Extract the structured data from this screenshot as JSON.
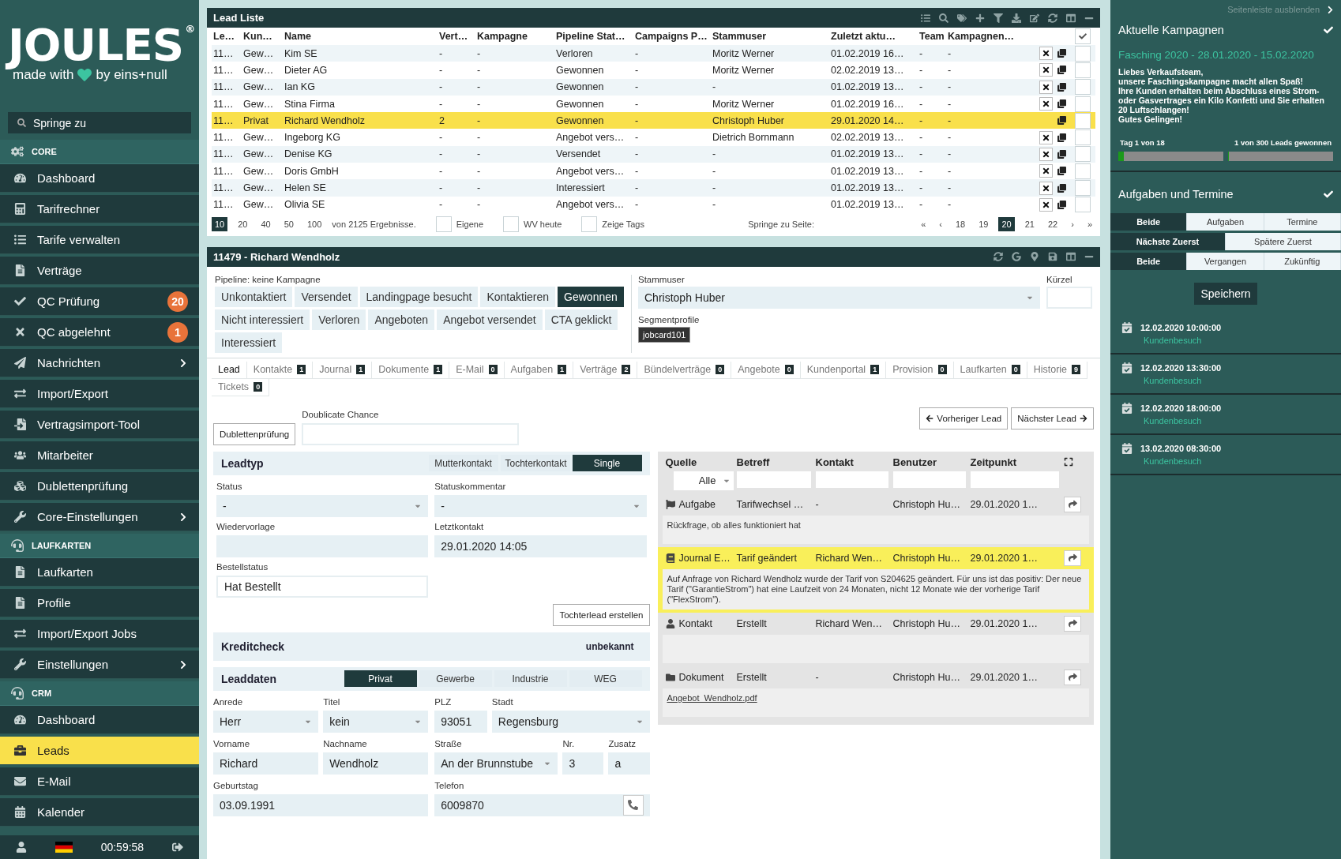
{
  "sidebar": {
    "logo": {
      "wordmark": "JOULES",
      "mark": "®",
      "tagline_start": "made with",
      "tagline_end": "by eins+null"
    },
    "search": {
      "placeholder": "Springe zu"
    },
    "sections": [
      {
        "title": "CORE",
        "items": [
          {
            "label": "Dashboard",
            "submenu": false,
            "selected": false
          },
          {
            "label": "Tarifrechner",
            "submenu": false,
            "selected": false
          },
          {
            "label": "Tarife verwalten",
            "submenu": false,
            "selected": false
          },
          {
            "label": "Verträge",
            "submenu": false,
            "selected": false
          },
          {
            "label": "QC Prüfung",
            "badge": "20",
            "submenu": false,
            "selected": false
          },
          {
            "label": "QC abgelehnt",
            "badge": "1",
            "submenu": false,
            "selected": false
          },
          {
            "label": "Nachrichten",
            "submenu": true,
            "selected": false
          },
          {
            "label": "Import/Export",
            "submenu": false,
            "selected": false
          },
          {
            "label": "Vertragsimport-Tool",
            "submenu": false,
            "selected": false
          },
          {
            "label": "Mitarbeiter",
            "submenu": false,
            "selected": false
          },
          {
            "label": "Dublettenprüfung",
            "submenu": false,
            "selected": false
          },
          {
            "label": "Core-Einstellungen",
            "submenu": true,
            "selected": false
          }
        ]
      },
      {
        "title": "LAUFKARTEN",
        "items": [
          {
            "label": "Laufkarten",
            "submenu": false,
            "selected": false
          },
          {
            "label": "Profile",
            "submenu": false,
            "selected": false
          },
          {
            "label": "Import/Export Jobs",
            "submenu": false,
            "selected": false
          },
          {
            "label": "Einstellungen",
            "submenu": true,
            "selected": false
          }
        ]
      },
      {
        "title": "CRM",
        "items": [
          {
            "label": "Dashboard",
            "submenu": false,
            "selected": false
          },
          {
            "label": "Leads",
            "submenu": false,
            "selected": true
          },
          {
            "label": "E-Mail",
            "submenu": false,
            "selected": false
          },
          {
            "label": "Kalender",
            "submenu": false,
            "selected": false
          }
        ]
      }
    ],
    "footer": {
      "time": "00:59:58"
    }
  },
  "lead_list": {
    "title": "Lead Liste",
    "all_checked": true,
    "columns": [
      "Le…",
      "Kun…",
      "Name",
      "Vert…",
      "Kampagne",
      "Pipeline Stat…",
      "Campaigns P…",
      "Stammuser",
      "Zuletzt aktu…",
      "Team",
      "Kampagnen…"
    ],
    "rows": [
      {
        "cells": [
          "11…",
          "Gew…",
          "Kim SE",
          "-",
          "-",
          "Verloren",
          "-",
          "Moritz Werner",
          "01.02.2019 16…",
          "-",
          "-"
        ],
        "deletable": true,
        "checked": false,
        "selected": false
      },
      {
        "cells": [
          "11…",
          "Gew…",
          "Dieter AG",
          "-",
          "-",
          "Gewonnen",
          "-",
          "Moritz Werner",
          "02.02.2019 13…",
          "-",
          "-"
        ],
        "deletable": true,
        "checked": false,
        "selected": false
      },
      {
        "cells": [
          "11…",
          "Gew…",
          "Ian KG",
          "-",
          "-",
          "Gewonnen",
          "-",
          "-",
          "01.02.2019 13…",
          "-",
          "-"
        ],
        "deletable": true,
        "checked": false,
        "selected": false
      },
      {
        "cells": [
          "11…",
          "Gew…",
          "Stina Firma",
          "-",
          "-",
          "Gewonnen",
          "-",
          "Moritz Werner",
          "01.02.2019 16…",
          "-",
          "-"
        ],
        "deletable": true,
        "checked": false,
        "selected": false
      },
      {
        "cells": [
          "11…",
          "Privat",
          "Richard Wendholz",
          "2",
          "-",
          "Gewonnen",
          "-",
          "Christoph Huber",
          "29.01.2020 14…",
          "-",
          "-"
        ],
        "deletable": false,
        "checked": false,
        "selected": true
      },
      {
        "cells": [
          "11…",
          "Gew…",
          "Ingeborg KG",
          "-",
          "-",
          "Angebot vers…",
          "-",
          "Dietrich Bornmann",
          "02.02.2019 13…",
          "-",
          "-"
        ],
        "deletable": true,
        "checked": false,
        "selected": false
      },
      {
        "cells": [
          "11…",
          "Gew…",
          "Denise KG",
          "-",
          "-",
          "Versendet",
          "-",
          "-",
          "01.02.2019 13…",
          "-",
          "-"
        ],
        "deletable": true,
        "checked": false,
        "selected": false
      },
      {
        "cells": [
          "11…",
          "Gew…",
          "Doris GmbH",
          "-",
          "-",
          "Angebot vers…",
          "-",
          "-",
          "01.02.2019 13…",
          "-",
          "-"
        ],
        "deletable": true,
        "checked": false,
        "selected": false
      },
      {
        "cells": [
          "11…",
          "Gew…",
          "Helen SE",
          "-",
          "-",
          "Interessiert",
          "-",
          "-",
          "01.02.2019 13…",
          "-",
          "-"
        ],
        "deletable": true,
        "checked": false,
        "selected": false
      },
      {
        "cells": [
          "11…",
          "Gew…",
          "Olivia SE",
          "-",
          "-",
          "Angebot vers…",
          "-",
          "-",
          "01.02.2019 13…",
          "-",
          "-"
        ],
        "deletable": true,
        "checked": false,
        "selected": false
      }
    ],
    "page_sizes": [
      {
        "label": "10",
        "selected": true
      },
      {
        "label": "20",
        "selected": false
      },
      {
        "label": "40",
        "selected": false
      },
      {
        "label": "50",
        "selected": false
      },
      {
        "label": "100",
        "selected": false
      }
    ],
    "result_count": "von 2125 Ergebnisse.",
    "filters": [
      {
        "label": "Eigene",
        "checked": false
      },
      {
        "label": "WV heute",
        "checked": false
      },
      {
        "label": "Zeige Tags",
        "checked": false
      }
    ],
    "jump_label": "Springe zu Seite:",
    "pages": [
      {
        "label": "«",
        "selected": false
      },
      {
        "label": "‹",
        "selected": false
      },
      {
        "label": "18",
        "selected": false
      },
      {
        "label": "19",
        "selected": false
      },
      {
        "label": "20",
        "selected": true
      },
      {
        "label": "21",
        "selected": false
      },
      {
        "label": "22",
        "selected": false
      },
      {
        "label": "›",
        "selected": false
      },
      {
        "label": "»",
        "selected": false
      }
    ]
  },
  "detail": {
    "title": "11479 - Richard Wendholz",
    "pipeline_label": "Pipeline: keine Kampagne",
    "stages": [
      {
        "label": "Unkontaktiert",
        "selected": false
      },
      {
        "label": "Versendet",
        "selected": false
      },
      {
        "label": "Landingpage besucht",
        "selected": false
      },
      {
        "label": "Kontaktieren",
        "selected": false
      },
      {
        "label": "Gewonnen",
        "selected": true
      },
      {
        "label": "Nicht interessiert",
        "selected": false
      },
      {
        "label": "Verloren",
        "selected": false
      },
      {
        "label": "Angeboten",
        "selected": false
      },
      {
        "label": "Angebot versendet",
        "selected": false
      },
      {
        "label": "CTA geklickt",
        "selected": false
      },
      {
        "label": "Interessiert",
        "selected": false
      }
    ],
    "owner": {
      "label": "Stammuser",
      "value": "Christoph Huber"
    },
    "short_label": "Kürzel",
    "segments": {
      "label": "Segmentprofile",
      "tags": [
        "jobcard101"
      ]
    },
    "tabs": [
      {
        "label": "Lead",
        "selected": true
      },
      {
        "label": "Kontakte",
        "count": "1",
        "selected": false
      },
      {
        "label": "Journal",
        "count": "1",
        "selected": false
      },
      {
        "label": "Dokumente",
        "count": "1",
        "selected": false
      },
      {
        "label": "E-Mail",
        "count": "0",
        "selected": false
      },
      {
        "label": "Aufgaben",
        "count": "1",
        "selected": false
      },
      {
        "label": "Verträge",
        "count": "2",
        "selected": false
      },
      {
        "label": "Bündelverträge",
        "count": "0",
        "selected": false
      },
      {
        "label": "Angebote",
        "count": "0",
        "selected": false
      },
      {
        "label": "Kundenportal",
        "count": "1",
        "selected": false
      },
      {
        "label": "Provision",
        "count": "0",
        "selected": false
      },
      {
        "label": "Laufkarten",
        "count": "0",
        "selected": false
      },
      {
        "label": "Historie",
        "count": "9",
        "selected": false
      },
      {
        "label": "Tickets",
        "count": "0",
        "selected": false
      }
    ],
    "duplicate_button": "Dublettenprüfung",
    "duplicate_label": "Doublicate Chance",
    "prev_button": "Vorheriger Lead",
    "next_button": "Nächster Lead",
    "lead_type": {
      "title": "Leadtyp",
      "options": [
        {
          "label": "Mutterkontakt",
          "selected": false
        },
        {
          "label": "Tochterkontakt",
          "selected": false
        },
        {
          "label": "Single",
          "selected": true
        }
      ]
    },
    "status_fields": [
      {
        "label": "Status",
        "value": "-",
        "kind": "select"
      },
      {
        "label": "Statuskommentar",
        "value": "-",
        "kind": "select"
      },
      {
        "label": "Wiedervorlage",
        "kind": "text"
      },
      {
        "label": "Letztkontakt",
        "value": "29.01.2020 14:05",
        "kind": "text"
      },
      {
        "label": "Bestellstatus",
        "value": "Hat Bestellt",
        "kind": "plain"
      }
    ],
    "child_button": "Tochterlead erstellen",
    "credit_check": {
      "title": "Kreditcheck",
      "value": "unbekannt"
    },
    "lead_data": {
      "title": "Leaddaten",
      "options": [
        {
          "label": "Privat",
          "selected": true
        },
        {
          "label": "Gewerbe",
          "selected": false
        },
        {
          "label": "Industrie",
          "selected": false
        },
        {
          "label": "WEG",
          "selected": false
        }
      ],
      "rows": [
        {
          "left": [
            {
              "label": "Anrede",
              "value": "Herr",
              "kind": "select"
            },
            {
              "label": "Titel",
              "value": "kein",
              "kind": "select"
            }
          ],
          "right": [
            {
              "label": "PLZ",
              "value": "93051",
              "kind": "text"
            },
            {
              "label": "Stadt",
              "value": "Regensburg",
              "kind": "select"
            }
          ]
        },
        {
          "left": [
            {
              "label": "Vorname",
              "value": "Richard",
              "kind": "text"
            },
            {
              "label": "Nachname",
              "value": "Wendholz",
              "kind": "text"
            }
          ],
          "right": [
            {
              "label": "Straße",
              "value": "An der Brunnstube",
              "kind": "select"
            },
            {
              "label": "Nr.",
              "value": "3",
              "kind": "text"
            },
            {
              "label": "Zusatz",
              "value": "a",
              "kind": "text"
            }
          ]
        },
        {
          "left": [
            {
              "label": "Geburtstag",
              "value": "03.09.1991",
              "kind": "text"
            }
          ],
          "right": [
            {
              "label": "Telefon",
              "value": "6009870",
              "kind": "phone"
            }
          ]
        }
      ]
    },
    "journal": {
      "columns": [
        "Quelle",
        "Betreff",
        "Kontakt",
        "Benutzer",
        "Zeitpunkt"
      ],
      "source_filter": "Alle",
      "entries": [
        {
          "kind": "task",
          "source": "Aufgabe",
          "subject": "Tarifwechsel …",
          "contact": "-",
          "user": "Christoph Hu…",
          "time": "29.01.2020 1…",
          "note": "Rückfrage, ob alles funktioniert hat",
          "selected": false
        },
        {
          "kind": "journal",
          "source": "Journal E…",
          "subject": "Tarif geändert",
          "contact": "Richard Wen…",
          "user": "Christoph Hu…",
          "time": "29.01.2020 1…",
          "note": "Auf Anfrage von Richard Wendholz wurde der Tarif von S204625 geändert. Für uns ist das positiv: Der neue Tarif (\"GarantieStrom\") hat eine Laufzeit von 24 Monaten, nicht 12 Monate wie der vorherige Tarif (\"FlexStrom\").",
          "selected": true
        },
        {
          "kind": "contact",
          "source": "Kontakt",
          "subject": "Erstellt",
          "contact": "Richard Wen…",
          "user": "Christoph Hu…",
          "time": "29.01.2020 1…",
          "selected": false
        },
        {
          "kind": "document",
          "source": "Dokument",
          "subject": "Erstellt",
          "contact": "-",
          "user": "Christoph Hu…",
          "time": "29.01.2020 1…",
          "attachment": "Angebot_Wendholz.pdf",
          "selected": false
        }
      ]
    }
  },
  "right_sidebar": {
    "hide_link": "Seitenleiste ausblenden",
    "campaigns": {
      "title": "Aktuelle Kampagnen",
      "name": "Fasching 2020 - 28.01.2020 - 15.02.2020",
      "message": "Liebes Verkaufsteam,\nunsere Faschingskampagne macht allen Spaß!\nIhre Kunden erhalten beim Abschluss eines Strom- oder Gasvertrages ein Kilo Konfetti und Sie erhalten 20 Luftschlangen!\nGutes Gelingen!",
      "progress": [
        {
          "label": "Tag 1 von 18",
          "level": 0.056
        },
        {
          "label": "1 von 300 Leads gewonnen",
          "level": 0.003
        }
      ]
    },
    "tasks": {
      "title": "Aufgaben und Termine",
      "filter_groups": [
        {
          "options": [
            {
              "label": "Beide",
              "selected": true
            },
            {
              "label": "Aufgaben",
              "selected": false
            },
            {
              "label": "Termine",
              "selected": false
            }
          ]
        },
        {
          "options": [
            {
              "label": "Nächste Zuerst",
              "selected": true
            },
            {
              "label": "Spätere Zuerst",
              "selected": false
            }
          ]
        },
        {
          "options": [
            {
              "label": "Beide",
              "selected": true
            },
            {
              "label": "Vergangen",
              "selected": false
            },
            {
              "label": "Zukünftig",
              "selected": false
            }
          ]
        }
      ],
      "save_button": "Speichern",
      "appointments": [
        {
          "datetime": "12.02.2020 10:00:00",
          "title": "Kundenbesuch"
        },
        {
          "datetime": "12.02.2020 13:30:00",
          "title": "Kundenbesuch"
        },
        {
          "datetime": "12.02.2020 18:00:00",
          "title": "Kundenbesuch"
        },
        {
          "datetime": "13.02.2020 08:30:00",
          "title": "Kundenbesuch"
        }
      ]
    }
  }
}
